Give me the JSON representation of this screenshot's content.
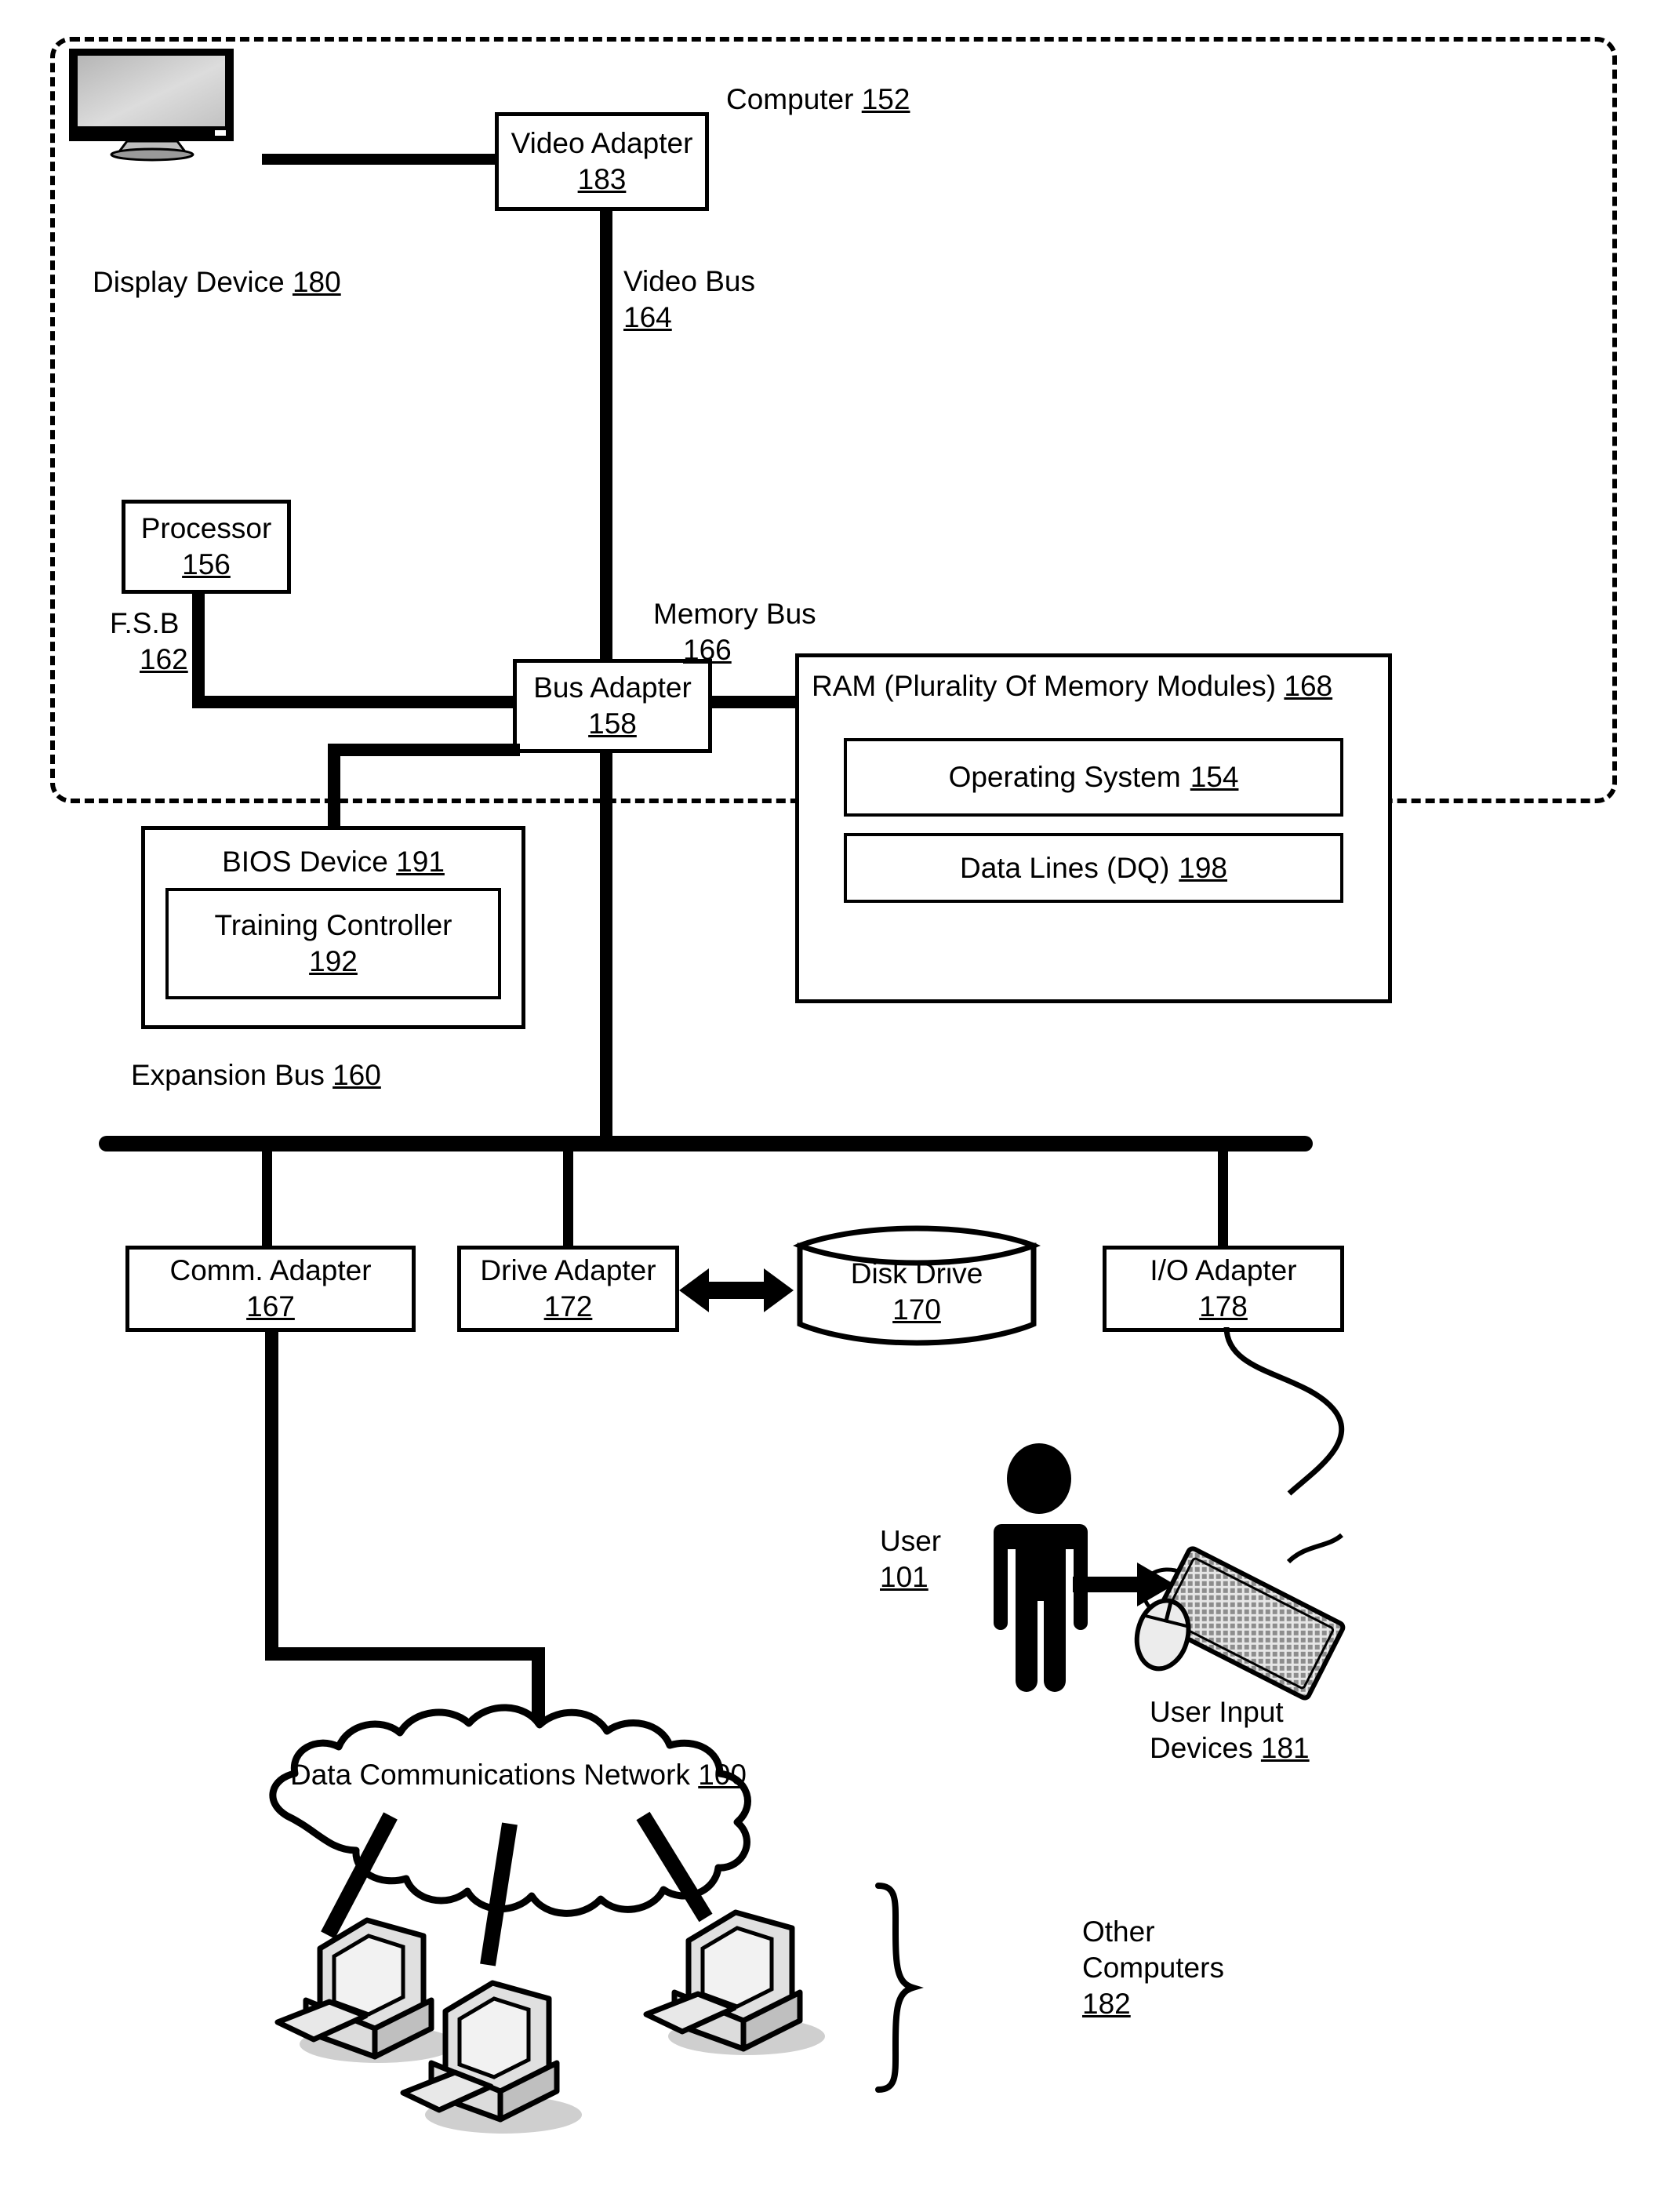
{
  "figure": {
    "enclosure_label": {
      "text": "Computer",
      "ref": "152"
    },
    "display_device": {
      "text": "Display Device",
      "ref": "180"
    },
    "video_adapter": {
      "text": "Video Adapter",
      "ref": "183"
    },
    "video_bus": {
      "text": "Video Bus",
      "ref": "164"
    },
    "processor": {
      "text": "Processor",
      "ref": "156"
    },
    "fsb": {
      "text": "F.S.B",
      "ref": "162"
    },
    "bus_adapter": {
      "text": "Bus Adapter",
      "ref": "158"
    },
    "memory_bus": {
      "text": "Memory Bus",
      "ref": "166"
    },
    "ram": {
      "text": "RAM (Plurality Of Memory Modules)",
      "ref": "168"
    },
    "operating_system": {
      "text": "Operating System",
      "ref": "154"
    },
    "data_lines": {
      "text": "Data Lines (DQ)",
      "ref": "198"
    },
    "bios_device": {
      "text": "BIOS Device",
      "ref": "191"
    },
    "training_controller": {
      "text": "Training Controller",
      "ref": "192"
    },
    "expansion_bus": {
      "text": "Expansion Bus",
      "ref": "160"
    },
    "comm_adapter": {
      "text": "Comm. Adapter",
      "ref": "167"
    },
    "drive_adapter": {
      "text": "Drive Adapter",
      "ref": "172"
    },
    "disk_drive": {
      "text": "Disk Drive",
      "ref": "170"
    },
    "io_adapter": {
      "text": "I/O Adapter",
      "ref": "178"
    },
    "user": {
      "text": "User",
      "ref": "101"
    },
    "user_input_devices": {
      "line1": "User Input",
      "line2": "Devices",
      "ref": "181"
    },
    "network": {
      "text": "Data Communications Network",
      "ref": "100"
    },
    "other_computers": {
      "line1": "Other",
      "line2": "Computers",
      "ref": "182"
    }
  },
  "colors": {
    "ink": "#000000",
    "paper": "#ffffff",
    "screen_fill": "#c9c9c9",
    "device_fill": "#d8d8d8"
  }
}
